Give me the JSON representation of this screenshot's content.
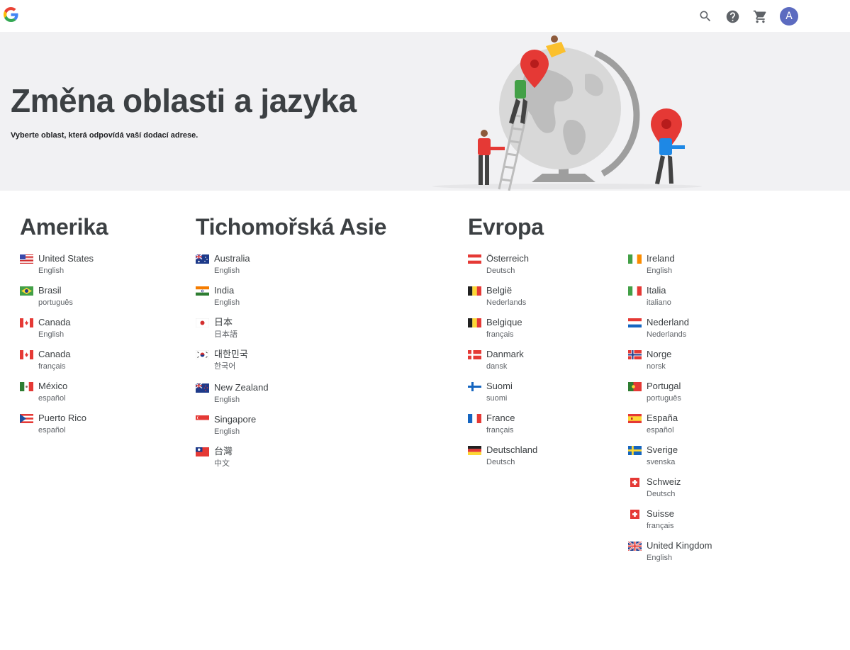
{
  "topbar": {
    "logo_icon": "google-g-logo",
    "icons": [
      "search-icon",
      "help-icon",
      "cart-icon"
    ],
    "avatar_letter": "A",
    "avatar_color": "#5c6bc0"
  },
  "hero": {
    "title": "Změna oblasti a jazyka",
    "subtitle": "Vyberte oblast, která odpovídá vaší dodací adrese.",
    "background": "#f1f1f3"
  },
  "regions": {
    "americas": {
      "title": "Amerika",
      "items": [
        {
          "country": "United States",
          "language": "English",
          "flag": "us"
        },
        {
          "country": "Brasil",
          "language": "português",
          "flag": "br"
        },
        {
          "country": "Canada",
          "language": "English",
          "flag": "ca"
        },
        {
          "country": "Canada",
          "language": "français",
          "flag": "ca"
        },
        {
          "country": "México",
          "language": "español",
          "flag": "mx"
        },
        {
          "country": "Puerto Rico",
          "language": "español",
          "flag": "pr"
        }
      ]
    },
    "asia_pacific": {
      "title": "Tichomořská Asie",
      "items": [
        {
          "country": "Australia",
          "language": "English",
          "flag": "au"
        },
        {
          "country": "India",
          "language": "English",
          "flag": "in"
        },
        {
          "country": "日本",
          "language": "日本語",
          "flag": "jp"
        },
        {
          "country": "대한민국",
          "language": "한국어",
          "flag": "kr"
        },
        {
          "country": "New Zealand",
          "language": "English",
          "flag": "nz"
        },
        {
          "country": "Singapore",
          "language": "English",
          "flag": "sg"
        },
        {
          "country": "台灣",
          "language": "中文",
          "flag": "tw"
        }
      ]
    },
    "europe": {
      "title": "Evropa",
      "items_col1": [
        {
          "country": "Österreich",
          "language": "Deutsch",
          "flag": "at"
        },
        {
          "country": "België",
          "language": "Nederlands",
          "flag": "be"
        },
        {
          "country": "Belgique",
          "language": "français",
          "flag": "be"
        },
        {
          "country": "Danmark",
          "language": "dansk",
          "flag": "dk"
        },
        {
          "country": "Suomi",
          "language": "suomi",
          "flag": "fi"
        },
        {
          "country": "France",
          "language": "français",
          "flag": "fr"
        },
        {
          "country": "Deutschland",
          "language": "Deutsch",
          "flag": "de"
        }
      ],
      "items_col2": [
        {
          "country": "Ireland",
          "language": "English",
          "flag": "ie"
        },
        {
          "country": "Italia",
          "language": "italiano",
          "flag": "it"
        },
        {
          "country": "Nederland",
          "language": "Nederlands",
          "flag": "nl"
        },
        {
          "country": "Norge",
          "language": "norsk",
          "flag": "no"
        },
        {
          "country": "Portugal",
          "language": "português",
          "flag": "pt"
        },
        {
          "country": "España",
          "language": "español",
          "flag": "es"
        },
        {
          "country": "Sverige",
          "language": "svenska",
          "flag": "se"
        },
        {
          "country": "Schweiz",
          "language": "Deutsch",
          "flag": "ch"
        },
        {
          "country": "Suisse",
          "language": "français",
          "flag": "ch"
        },
        {
          "country": "United Kingdom",
          "language": "English",
          "flag": "gb"
        }
      ]
    }
  }
}
